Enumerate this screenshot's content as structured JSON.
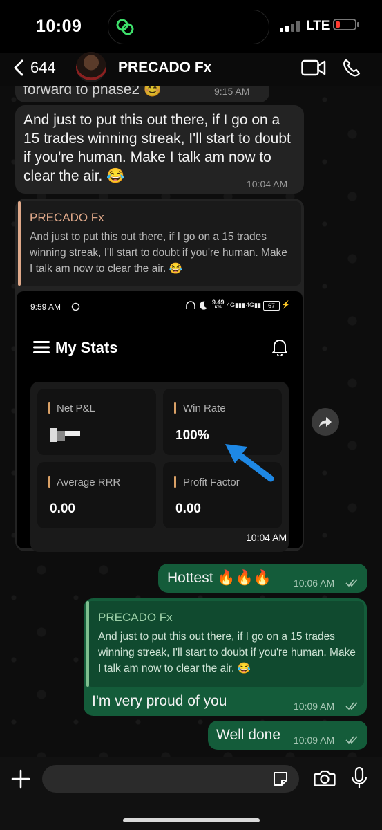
{
  "status_bar": {
    "time": "10:09",
    "network": "LTE"
  },
  "header": {
    "back_count": "644",
    "contact_name": "PRECADO Fx"
  },
  "messages": {
    "m0": {
      "text_partial": "forward to phase2 😊",
      "time": "9:15 AM"
    },
    "m1": {
      "text": "And just to put this out there, if I go on a 15 trades winning streak, I'll start to doubt if you're human. Make I talk am now to clear the air. 😂",
      "time": "10:04 AM"
    },
    "m2": {
      "quote_name": "PRECADO Fx",
      "quote_text": "And just to put this out there, if I go on a 15 trades winning streak, I'll start to doubt if you're human. Make I talk am now to clear the air. 😂",
      "time": "10:04 AM",
      "screenshot": {
        "time": "9:59 AM",
        "speed": "9.49",
        "speed_unit": "K/S",
        "battery": "67",
        "title": "My Stats",
        "cards": [
          {
            "label": "Net P&L",
            "value": ""
          },
          {
            "label": "Win Rate",
            "value": "100%"
          },
          {
            "label": "Average RRR",
            "value": "0.00"
          },
          {
            "label": "Profit Factor",
            "value": "0.00"
          }
        ]
      }
    },
    "m3": {
      "text": "Hottest 🔥🔥🔥",
      "time": "10:06 AM"
    },
    "m4": {
      "quote_name": "PRECADO Fx",
      "quote_text": "And just to put this out there, if I go on a 15 trades winning streak, I'll start to doubt if you're human. Make I talk am now to clear the air. 😂",
      "text": "I'm very proud of you",
      "time": "10:09 AM"
    },
    "m5": {
      "text": "Well done",
      "time": "10:09 AM"
    }
  },
  "composer": {
    "placeholder": ""
  },
  "colors": {
    "outgoing_bubble": "#145c3a",
    "incoming_bubble": "#232323",
    "quote_accent": "#e0a98a",
    "annotation_arrow": "#1e88e5"
  },
  "icons": [
    "back-icon",
    "video-call-icon",
    "phone-icon",
    "forward-icon",
    "plus-icon",
    "sticker-icon",
    "camera-icon",
    "mic-icon",
    "menu-icon",
    "bell-icon",
    "read-receipt-icon"
  ]
}
